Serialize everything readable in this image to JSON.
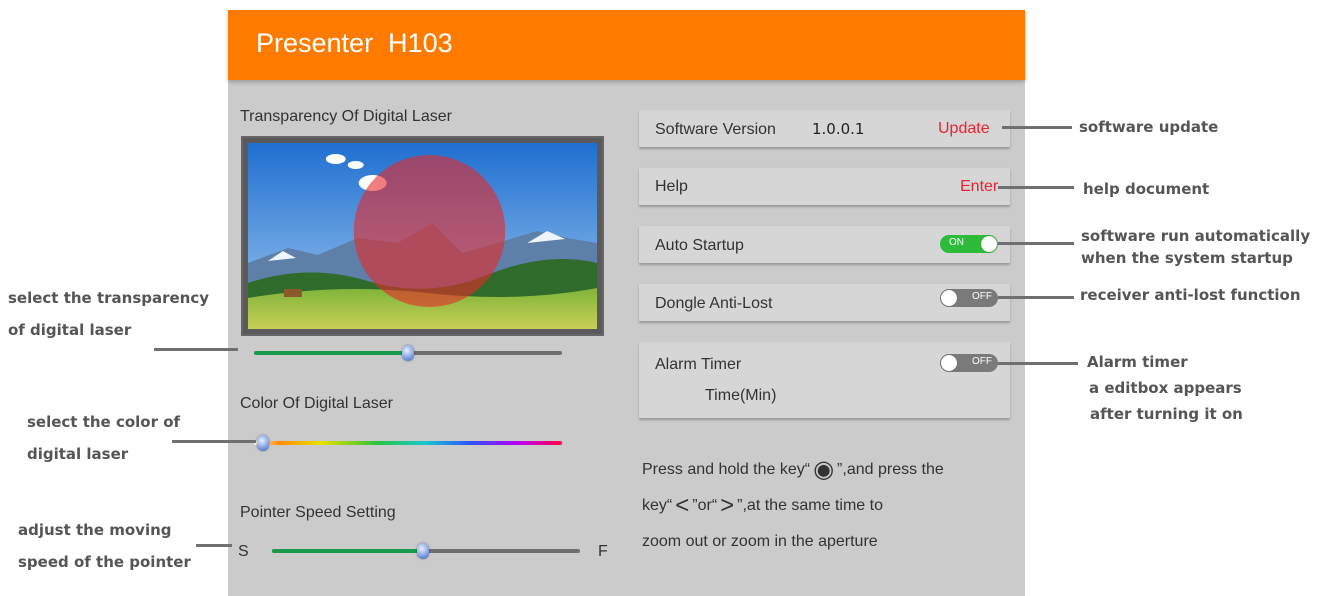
{
  "app": {
    "title": "Presenter  H103",
    "accent_color": "#ff7b00"
  },
  "left_panel": {
    "transparency_label": "Transparency Of Digital Laser",
    "transparency_value": 0.5,
    "color_label": "Color Of Digital Laser",
    "color_value": 0.03,
    "speed_label": "Pointer Speed Setting",
    "speed_min_label": "S",
    "speed_max_label": "F",
    "speed_value": 0.49
  },
  "right_panel": {
    "software_version_label": "Software Version",
    "software_version_value": "1.0.0.1",
    "update_link": "Update",
    "help_label": "Help",
    "help_link": "Enter",
    "auto_startup_label": "Auto Startup",
    "auto_startup_toggle": "ON",
    "dongle_label": "Dongle Anti-Lost",
    "dongle_toggle": "OFF",
    "alarm_label": "Alarm Timer",
    "alarm_toggle": "OFF",
    "alarm_sub_label": "Time(Min)",
    "hint_line1_a": "Press and hold the key",
    "hint_line1_b": ",and press the",
    "hint_line2_a": "key",
    "hint_line2_or": "or",
    "hint_line2_b": ",at the same time to",
    "hint_line3": "zoom out or zoom in the aperture"
  },
  "annotations": {
    "left": {
      "transparency": [
        "select the transparency",
        "of digital laser"
      ],
      "color": [
        "select the color of",
        "digital laser"
      ],
      "speed": [
        "adjust the moving",
        "speed of the pointer"
      ]
    },
    "right": {
      "update": "software update",
      "help": "help document",
      "autostart": [
        "software run automatically",
        "when the system startup"
      ],
      "dongle": "receiver anti-lost function",
      "alarm": [
        "Alarm timer",
        "a editbox appears",
        "after turning it on"
      ]
    }
  }
}
